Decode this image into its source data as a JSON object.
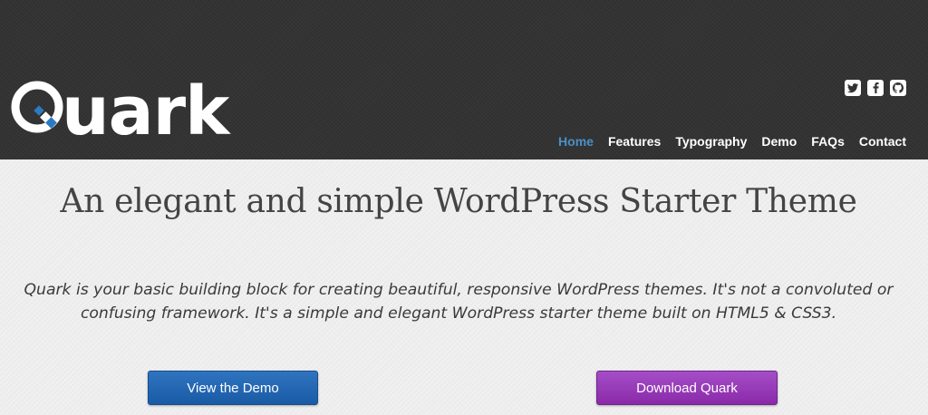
{
  "brand": {
    "logo_text": "uark",
    "logo_initial": "Q",
    "accent_color": "#2b7bc1"
  },
  "social": [
    {
      "name": "twitter-icon"
    },
    {
      "name": "facebook-icon"
    },
    {
      "name": "github-icon"
    }
  ],
  "nav": {
    "items": [
      "Home",
      "Features",
      "Typography",
      "Demo",
      "FAQs",
      "Contact"
    ],
    "active": "Home",
    "active_color": "#4a90c8"
  },
  "hero": {
    "headline": "An elegant and simple WordPress Starter Theme",
    "intro": "Quark is your basic building block for creating beautiful, responsive WordPress themes. It's not a convoluted or confusing framework. It's a simple and elegant WordPress starter theme built on HTML5 & CSS3.",
    "demo_button": "View the Demo",
    "download_button": "Download Quark",
    "demo_color": "#2466b3",
    "download_color": "#9a3cbc"
  }
}
